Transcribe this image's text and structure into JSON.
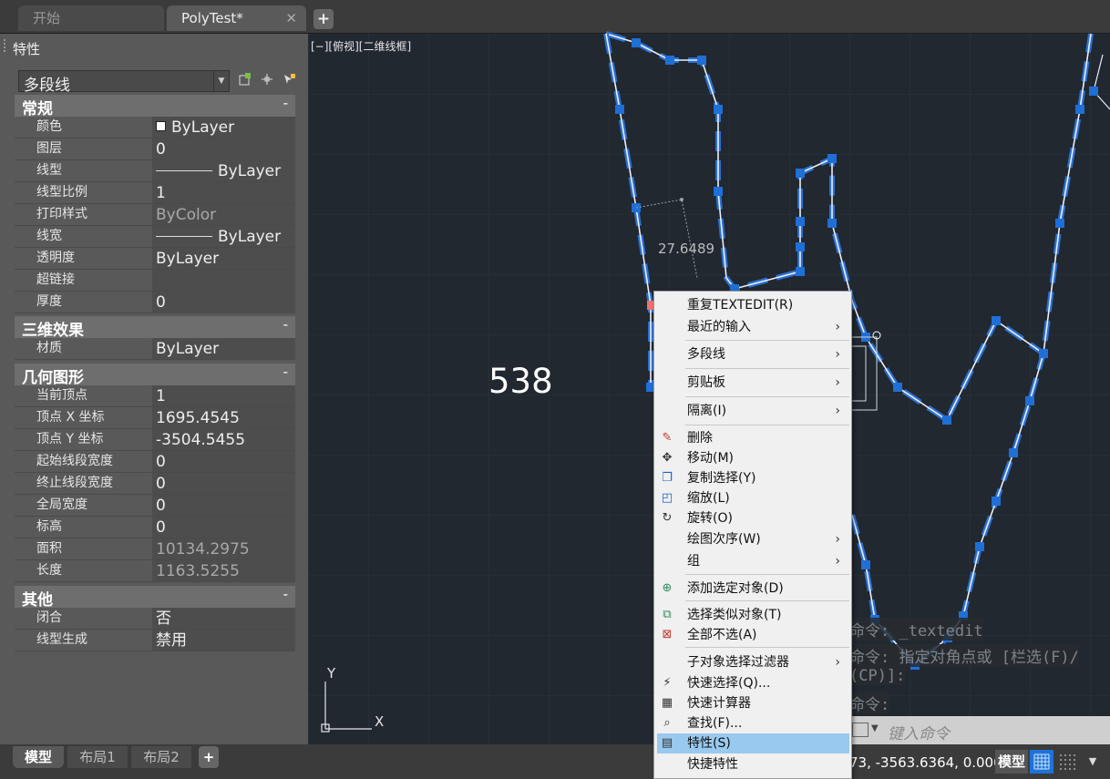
{
  "tabs": {
    "start": "开始",
    "active": "PolyTest*",
    "close": "✕",
    "new": "+"
  },
  "palette": {
    "title": "特性",
    "object_type": "多段线",
    "sections": {
      "general": "常规",
      "three_d": "三维效果",
      "geometry": "几何图形",
      "misc": "其他",
      "collapse": "-"
    },
    "general_rows": [
      {
        "key": "颜色",
        "value": "ByLayer"
      },
      {
        "key": "图层",
        "value": "0"
      },
      {
        "key": "线型",
        "value": "ByLayer"
      },
      {
        "key": "线型比例",
        "value": "1"
      },
      {
        "key": "打印样式",
        "value": "ByColor"
      },
      {
        "key": "线宽",
        "value": "ByLayer"
      },
      {
        "key": "透明度",
        "value": "ByLayer"
      },
      {
        "key": "超链接",
        "value": ""
      },
      {
        "key": "厚度",
        "value": "0"
      }
    ],
    "three_d_rows": [
      {
        "key": "材质",
        "value": "ByLayer"
      }
    ],
    "geometry_rows": [
      {
        "key": "当前顶点",
        "value": "1"
      },
      {
        "key": "顶点 X 坐标",
        "value": "1695.4545"
      },
      {
        "key": "顶点 Y 坐标",
        "value": "-3504.5455"
      },
      {
        "key": "起始线段宽度",
        "value": "0"
      },
      {
        "key": "终止线段宽度",
        "value": "0"
      },
      {
        "key": "全局宽度",
        "value": "0"
      },
      {
        "key": "标高",
        "value": "0"
      },
      {
        "key": "面积",
        "value": "10134.2975"
      },
      {
        "key": "长度",
        "value": "1163.5255"
      }
    ],
    "misc_rows": [
      {
        "key": "闭合",
        "value": "否"
      },
      {
        "key": "线型生成",
        "value": "禁用"
      }
    ]
  },
  "viewport": {
    "label": "[−][俯视][二维线框]",
    "big_number": "538",
    "dimension_value": "27.6489",
    "ucs_x": "X",
    "ucs_y": "Y"
  },
  "command": {
    "line1": "命令: _textedit",
    "line2": "命令: 指定对角点或 [栏选(F)/",
    "line3": "(CP)]:",
    "line4": "命令:",
    "placeholder": "键入命令"
  },
  "layout_tabs": {
    "model": "模型",
    "layout1": "布局1",
    "layout2": "布局2",
    "add": "+"
  },
  "status": {
    "coords": "73, -3563.6364, 0.0000",
    "model": "模型"
  },
  "context_menu": {
    "items": [
      {
        "label": "重复TEXTEDIT(R)",
        "icon": ""
      },
      {
        "label": "最近的输入",
        "icon": "",
        "submenu": "›"
      },
      {
        "label": "多段线",
        "icon": "",
        "submenu": "›"
      },
      {
        "label": "剪贴板",
        "icon": "",
        "submenu": "›"
      },
      {
        "label": "隔离(I)",
        "icon": "",
        "submenu": "›"
      },
      {
        "label": "删除",
        "icon": "eraser-icon"
      },
      {
        "label": "移动(M)",
        "icon": "move-icon"
      },
      {
        "label": "复制选择(Y)",
        "icon": "copy-icon"
      },
      {
        "label": "缩放(L)",
        "icon": "scale-icon"
      },
      {
        "label": "旋转(O)",
        "icon": "rotate-icon"
      },
      {
        "label": "绘图次序(W)",
        "icon": "",
        "submenu": "›"
      },
      {
        "label": "组",
        "icon": "",
        "submenu": "›"
      },
      {
        "label": "添加选定对象(D)",
        "icon": "add-selected-icon"
      },
      {
        "label": "选择类似对象(T)",
        "icon": "select-similar-icon"
      },
      {
        "label": "全部不选(A)",
        "icon": "deselect-all-icon"
      },
      {
        "label": "子对象选择过滤器",
        "icon": "",
        "submenu": "›"
      },
      {
        "label": "快速选择(Q)...",
        "icon": "quick-select-icon"
      },
      {
        "label": "快速计算器",
        "icon": "calculator-icon"
      },
      {
        "label": "查找(F)...",
        "icon": "find-icon"
      },
      {
        "label": "特性(S)",
        "icon": "properties-icon"
      },
      {
        "label": "快捷特性",
        "icon": ""
      }
    ]
  },
  "colors": {
    "canvas": "#212830",
    "polyline": "#e8f0ff",
    "grip": "#1f6fd6",
    "highlight": "#1e73d8",
    "menu_hover": "#99c9ef"
  }
}
